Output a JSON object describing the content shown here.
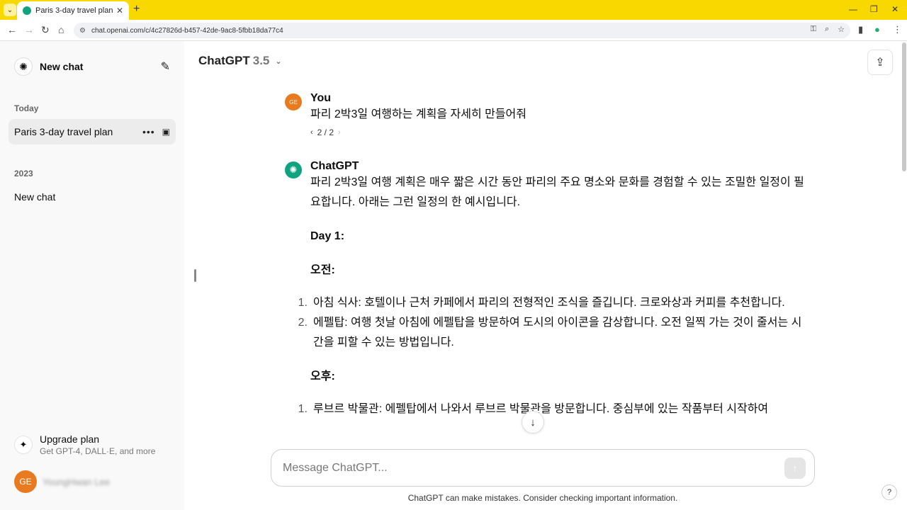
{
  "browser": {
    "tab_title": "Paris 3-day travel plan",
    "url": "chat.openai.com/c/4c27826d-b457-42de-9ac8-5fbb18da77c4"
  },
  "sidebar": {
    "new_chat_label": "New chat",
    "sections": [
      {
        "label": "Today",
        "items": [
          {
            "label": "Paris 3-day travel plan",
            "active": true
          }
        ]
      },
      {
        "label": "2023",
        "items": [
          {
            "label": "New chat",
            "active": false
          }
        ]
      }
    ],
    "upgrade": {
      "title": "Upgrade plan",
      "subtitle": "Get GPT-4, DALL·E, and more"
    },
    "user": {
      "initials": "GE",
      "name": "YoungHwan Lee"
    }
  },
  "header": {
    "model_name": "ChatGPT",
    "model_version": "3.5"
  },
  "messages": {
    "user": {
      "author": "You",
      "initials": "GE",
      "text": "파리 2박3일 여행하는 계획을 자세히 만들어줘",
      "pager": "2 / 2"
    },
    "assistant": {
      "author": "ChatGPT",
      "intro": "파리 2박3일 여행 계획은 매우 짧은 시간 동안 파리의 주요 명소와 문화를 경험할 수 있는 조밀한 일정이 필요합니다. 아래는 그런 일정의 한 예시입니다.",
      "day1": "Day 1:",
      "morning": "오전:",
      "morning_items": [
        {
          "num": "1.",
          "text": "아침 식사: 호텔이나 근처 카페에서 파리의 전형적인 조식을 즐깁니다. 크로와상과 커피를 추천합니다."
        },
        {
          "num": "2.",
          "text": "에펠탑: 여행 첫날 아침에 에펠탑을 방문하여 도시의 아이콘을 감상합니다. 오전 일찍 가는 것이 줄서는 시간을 피할 수 있는 방법입니다."
        }
      ],
      "afternoon": "오후:",
      "afternoon_items": [
        {
          "num": "1.",
          "text": "루브르 박물관: 에펠탑에서 나와서 루브르 박물관을 방문합니다. 중심부에 있는 작품부터 시작하여"
        }
      ]
    }
  },
  "composer": {
    "placeholder": "Message ChatGPT..."
  },
  "footer": {
    "disclaimer": "ChatGPT can make mistakes. Consider checking important information.",
    "help": "?"
  }
}
